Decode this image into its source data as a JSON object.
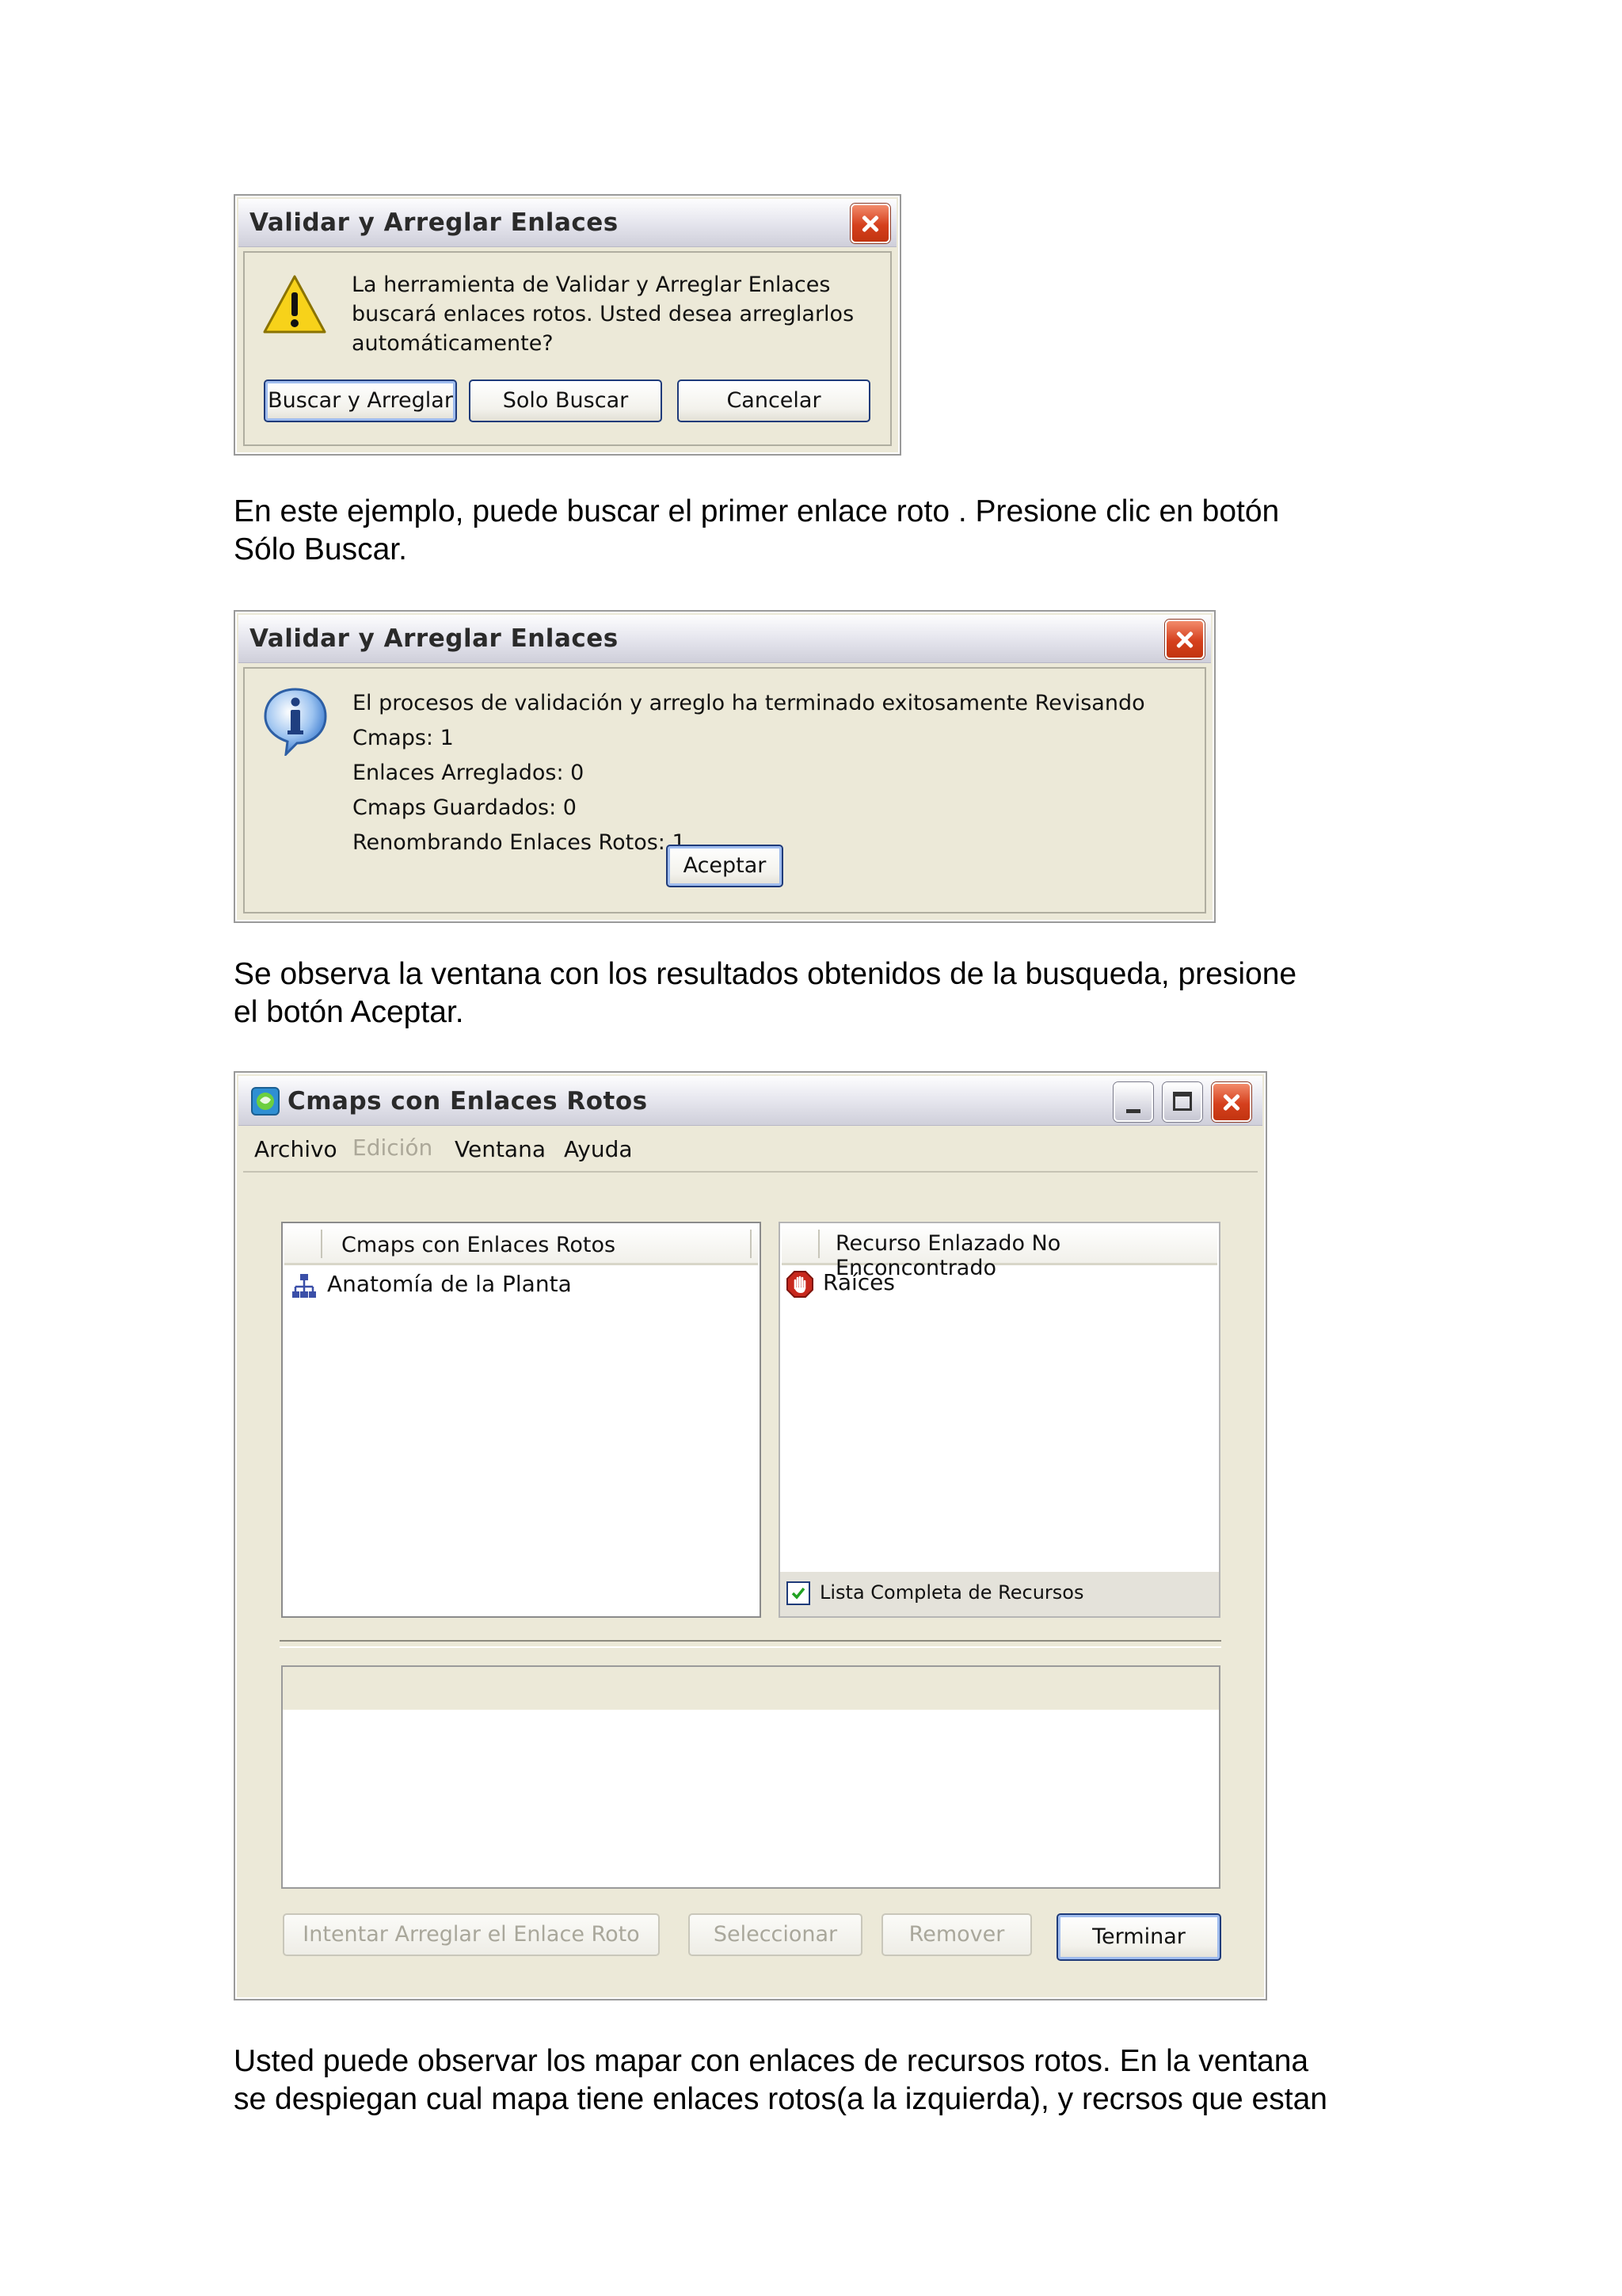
{
  "dialog1": {
    "title": "Validar y Arreglar Enlaces",
    "message": [
      "La herramienta de Validar y Arreglar Enlaces",
      "buscará enlaces rotos. Usted desea arreglarlos",
      "automáticamente?"
    ],
    "buttons": {
      "fix": "Buscar y Arreglar",
      "search": "Solo Buscar",
      "cancel": "Cancelar"
    }
  },
  "para1": [
    "En este ejemplo, puede buscar el primer enlace roto . Presione clic en botón",
    "Sólo Buscar."
  ],
  "dialog2": {
    "title": "Validar y Arreglar Enlaces",
    "message": [
      "El procesos de validación y arreglo ha terminado exitosamente Revisando Cmaps:  1",
      "Enlaces Arreglados:  0",
      "Cmaps Guardados:  0",
      "Renombrando Enlaces Rotos:  1"
    ],
    "ok": "Aceptar"
  },
  "para2": [
    "Se observa la ventana con los resultados obtenidos de la busqueda, presione",
    "el botón Aceptar."
  ],
  "window3": {
    "title": "Cmaps con Enlaces Rotos",
    "menu": {
      "archivo": "Archivo",
      "edicion": "Edición",
      "ventana": "Ventana",
      "ayuda": "Ayuda"
    },
    "left_header": "Cmaps con Enlaces Rotos",
    "left_items": [
      "Anatomía de la Planta"
    ],
    "right_header": "Recurso Enlazado No Enconcontrado",
    "right_items": [
      "Raíces"
    ],
    "checkbox_label": "Lista Completa de Recursos",
    "checkbox_checked": true,
    "buttons": {
      "try_fix": "Intentar Arreglar el Enlace Roto",
      "select": "Seleccionar",
      "remove": "Remover",
      "finish": "Terminar"
    }
  },
  "para3": [
    "Usted puede observar los mapar con enlaces de recursos rotos. En la ventana",
    "se despiegan cual mapa tiene enlaces rotos(a la izquierda), y recrsos que estan"
  ],
  "colors": {
    "close_red": "#d5401d",
    "panel": "#ece9d8",
    "focus_border": "#1f3b7a"
  }
}
